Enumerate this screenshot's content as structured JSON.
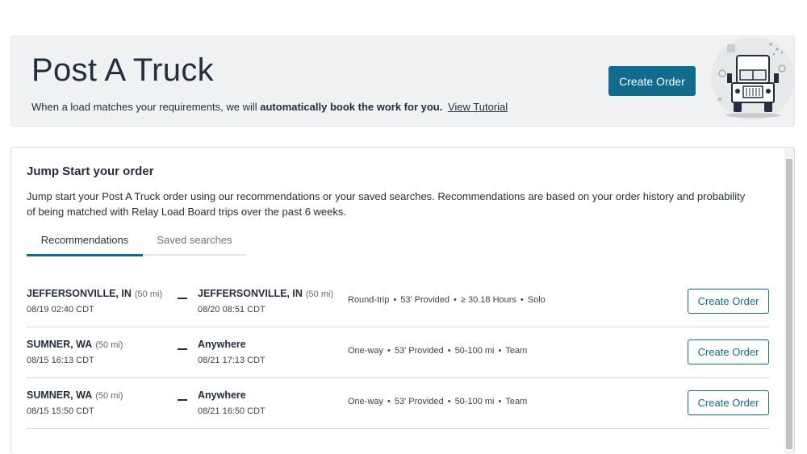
{
  "header": {
    "title": "Post A Truck",
    "subtitle_prefix": "When a load matches your requirements, we will",
    "subtitle_bold": "automatically book the work for you.",
    "tutorial_link": "View Tutorial",
    "create_order_label": "Create Order"
  },
  "card": {
    "title": "Jump Start your order",
    "description": "Jump start your Post A Truck order using our recommendations or your saved searches. Recommendations are based on your order history and probability of being matched with Relay Load Board trips over the past 6 weeks.",
    "tabs": [
      {
        "label": "Recommendations",
        "active": true
      },
      {
        "label": "Saved searches",
        "active": false
      }
    ]
  },
  "rows": [
    {
      "origin_city": "JEFFERSONVILLE, IN",
      "origin_radius": "(50 mi)",
      "origin_time": "08/19 02:40 CDT",
      "dest_city": "JEFFERSONVILLE, IN",
      "dest_radius": "(50 mi)",
      "dest_time": "08/20 08:51 CDT",
      "meta": [
        "Round-trip",
        "53' Provided",
        "≥ 30.18 Hours",
        "Solo"
      ],
      "button": "Create Order"
    },
    {
      "origin_city": "SUMNER, WA",
      "origin_radius": "(50 mi)",
      "origin_time": "08/15 16:13 CDT",
      "dest_city": "Anywhere",
      "dest_radius": "",
      "dest_time": "08/21 17:13 CDT",
      "meta": [
        "One-way",
        "53' Provided",
        "50-100 mi",
        "Team"
      ],
      "button": "Create Order"
    },
    {
      "origin_city": "SUMNER, WA",
      "origin_radius": "(50 mi)",
      "origin_time": "08/15 15:50 CDT",
      "dest_city": "Anywhere",
      "dest_radius": "",
      "dest_time": "08/21 16:50 CDT",
      "meta": [
        "One-way",
        "53' Provided",
        "50-100 mi",
        "Team"
      ],
      "button": "Create Order"
    }
  ],
  "colors": {
    "accent": "#0f6c8f",
    "text": "#232f3e",
    "banner_bg": "#f0f1f2"
  },
  "icons": {
    "truck": "truck-illustration",
    "separator": "bullet-dot"
  }
}
